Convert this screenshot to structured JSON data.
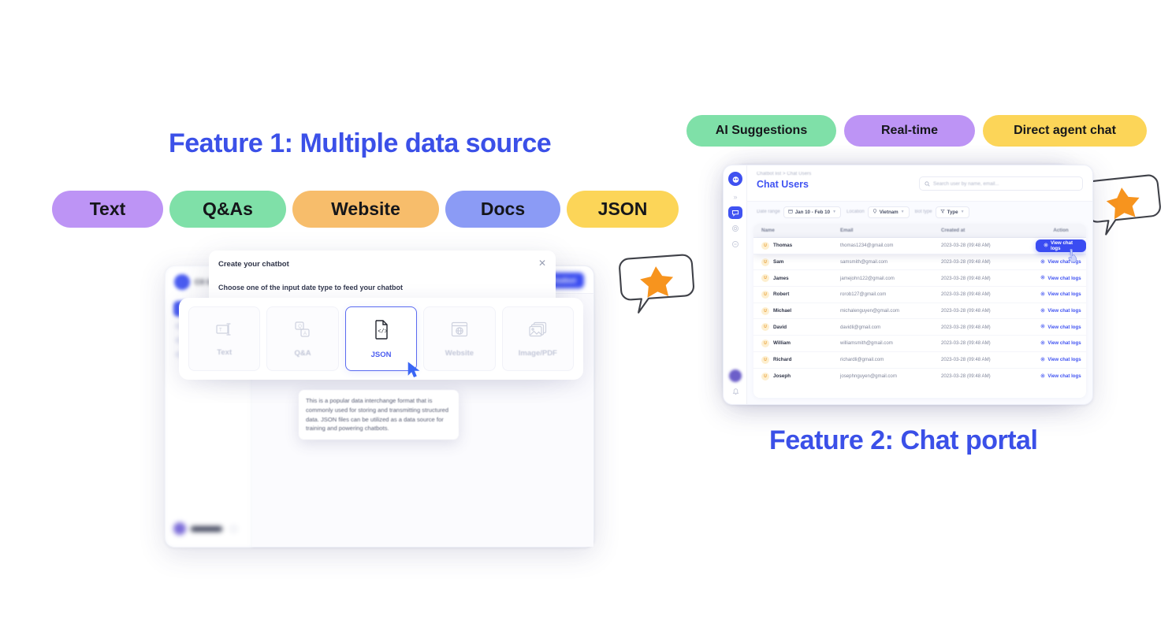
{
  "headings": {
    "feature1": "Feature 1: Multiple data source",
    "feature2": "Feature 2: Chat portal",
    "color": "#3b50e8"
  },
  "source_pills": [
    {
      "label": "Text",
      "color": "#bd94f5"
    },
    {
      "label": "Q&As",
      "color": "#7fe0a8"
    },
    {
      "label": "Website",
      "color": "#f7bd6b"
    },
    {
      "label": "Docs",
      "color": "#8b9bf5"
    },
    {
      "label": "JSON",
      "color": "#fcd558"
    }
  ],
  "feature_pills": [
    {
      "label": "AI Suggestions",
      "color": "#7fe0a8"
    },
    {
      "label": "Real-time",
      "color": "#bd94f5"
    },
    {
      "label": "Direct agent chat",
      "color": "#fcd558"
    }
  ],
  "app_window_1": {
    "brand": "CX Gen",
    "new_chatbot_button": "New Chatbot",
    "user_name": "Nhung Do"
  },
  "modal": {
    "title": "Create your chatbot",
    "close_icon": "close-icon",
    "subtitle": "Choose one of the input date type to feed your chatbot",
    "cards": [
      {
        "label": "Text",
        "icon": "text-input-icon",
        "selected": false
      },
      {
        "label": "Q&A",
        "icon": "qa-icon",
        "selected": false
      },
      {
        "label": "JSON",
        "icon": "json-file-icon",
        "selected": true
      },
      {
        "label": "Website",
        "icon": "globe-window-icon",
        "selected": false
      },
      {
        "label": "Image/PDF",
        "icon": "image-stack-icon",
        "selected": false
      }
    ],
    "tooltip": "This is a popular data interchange format that is commonly used for storing and transmitting structured data. JSON files can be utilized as a data source for training and powering chatbots."
  },
  "chat_portal": {
    "breadcrumb": "Chatbot list  >  Chat Users",
    "title": "Chat Users",
    "search_placeholder": "Search user by name, email...",
    "sidebar": [
      {
        "name": "logo",
        "icon": "chatbot-logo-icon"
      },
      {
        "name": "collapse",
        "icon": "chevrons-right-icon"
      },
      {
        "name": "chat-users",
        "icon": "chat-users-icon",
        "active": true
      },
      {
        "name": "settings",
        "icon": "gear-icon"
      },
      {
        "name": "help",
        "icon": "help-circle-icon"
      },
      {
        "name": "avatar",
        "icon": "avatar-icon"
      },
      {
        "name": "notifications",
        "icon": "bell-icon"
      }
    ],
    "filters": [
      {
        "label": "Date range",
        "value": "Jan 10 - Feb 10",
        "icon": "calendar-icon"
      },
      {
        "label": "Location",
        "value": "Vietnam",
        "icon": "location-pin-icon"
      },
      {
        "label": "Bot type",
        "value": "Type",
        "icon": "funnel-icon"
      }
    ],
    "columns": [
      "Name",
      "Email",
      "Created at",
      "Action"
    ],
    "action_label": "View chat logs",
    "rows": [
      {
        "name": "Thomas",
        "initial": "U",
        "email": "thomas1234@gmail.com",
        "created": "2023-03-28 (09:48 AM)",
        "highlight": true
      },
      {
        "name": "Sam",
        "initial": "U",
        "email": "samsmith@gmail.com",
        "created": "2023-03-28 (09:48 AM)",
        "highlight": false
      },
      {
        "name": "James",
        "initial": "U",
        "email": "jamejohn122@gmail.com",
        "created": "2023-03-28 (09:48 AM)",
        "highlight": false
      },
      {
        "name": "Robert",
        "initial": "U",
        "email": "rorob127@gmail.com",
        "created": "2023-03-28 (09:48 AM)",
        "highlight": false
      },
      {
        "name": "Michael",
        "initial": "U",
        "email": "michalenguyen@gmail.com",
        "created": "2023-03-28 (09:48 AM)",
        "highlight": false
      },
      {
        "name": "David",
        "initial": "U",
        "email": "davidli@gmail.com",
        "created": "2023-03-28 (09:48 AM)",
        "highlight": false
      },
      {
        "name": "William",
        "initial": "U",
        "email": "williamsmith@gmail.com",
        "created": "2023-03-28 (09:48 AM)",
        "highlight": false
      },
      {
        "name": "Richard",
        "initial": "U",
        "email": "richardli@gmail.com",
        "created": "2023-03-28 (09:48 AM)",
        "highlight": false
      },
      {
        "name": "Joseph",
        "initial": "U",
        "email": "josephnguyen@gmail.com",
        "created": "2023-03-28 (09:48 AM)",
        "highlight": false
      }
    ]
  },
  "decorations": {
    "star_bubbles": 2,
    "star_color": "#f7941e",
    "bubble_stroke": "#3f4148"
  }
}
